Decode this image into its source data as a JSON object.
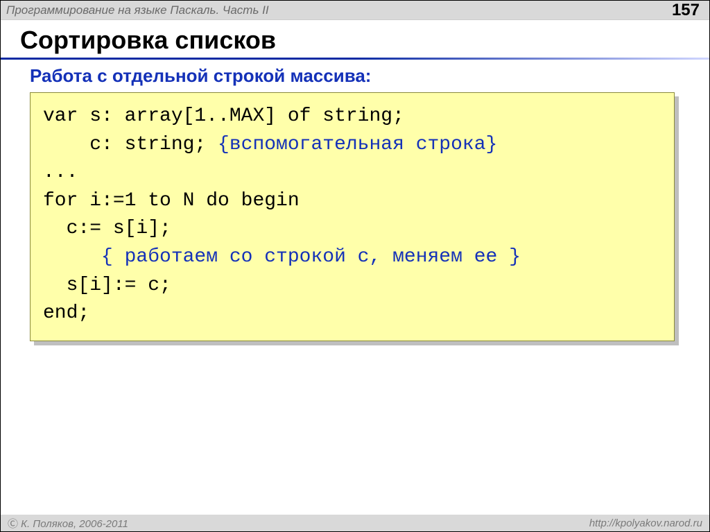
{
  "header": {
    "course_title": "Программирование на языке Паскаль. Часть II",
    "page_number": "157"
  },
  "content": {
    "title": "Сортировка списков",
    "subtitle": "Работа с отдельной строкой массива:",
    "code": {
      "line1": "var s: array[1..MAX] of string;",
      "line2a": "    c: string; ",
      "line2b_comment": "{вспомогательная строка}",
      "line3": "...",
      "line4": "for i:=1 to N do begin",
      "line5": "  c:= s[i];",
      "line6_comment": "     { работаем со строкой c, меняем ее }",
      "line7": "  s[i]:= c;",
      "line8": "end;"
    }
  },
  "footer": {
    "copyright": " К. Поляков, 2006-2011",
    "url": "http://kpolyakov.narod.ru"
  }
}
